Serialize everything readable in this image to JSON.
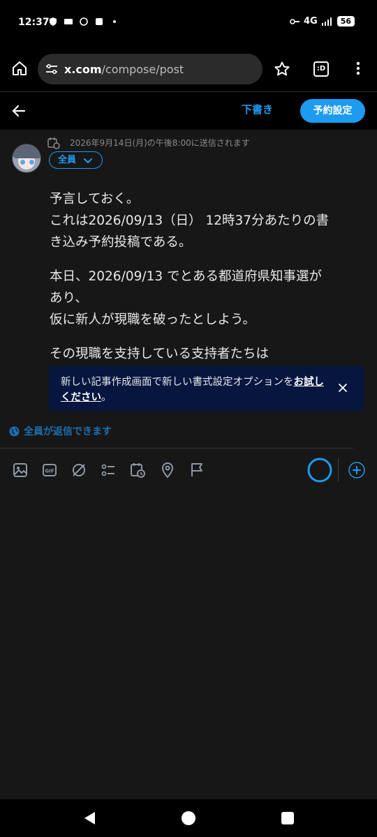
{
  "status_bar": {
    "time": "12:37",
    "network": "4G",
    "battery": "56",
    "icons": [
      "shield-icon",
      "mail-icon",
      "chatgpt-icon",
      "app-icon",
      "dot-icon",
      "key-icon",
      "signal-icon"
    ]
  },
  "browser": {
    "url_host": "x.com",
    "url_path": "/compose/post",
    "tab_label": ":D",
    "icons": [
      "home-icon",
      "site-settings-icon",
      "star-icon",
      "tabs-icon",
      "more-vert-icon"
    ]
  },
  "compose_header": {
    "draft_label": "下書き",
    "schedule_label": "予約設定"
  },
  "compose": {
    "scheduled_note": "2026年9月14日(月)の午後8:00に送信されます",
    "audience_label": "全員",
    "post_paragraphs": [
      [
        "予言しておく。",
        "これは2026/09/13（日） 12時37分あたりの書",
        "き込み予約投稿である。"
      ],
      [
        "本日、2026/09/13 でとある都道府県知事選が",
        "あり、",
        "仮に新人が現職を破ったとしよう。"
      ],
      [
        "その現職を支持している支持者たちは"
      ]
    ],
    "reply_setting": "全員が返信できます"
  },
  "toast": {
    "text": "新しい記事作成画面で新しい書式設定オプションを",
    "link": "お試しください",
    "suffix": "。"
  },
  "toolbar": {
    "icons": [
      "image-icon",
      "gif-icon",
      "grok-icon",
      "poll-icon",
      "schedule-icon",
      "location-icon",
      "flag-icon"
    ]
  },
  "colors": {
    "accent": "#1d9bf0",
    "toast_bg": "#06163f",
    "background": "#171717"
  }
}
